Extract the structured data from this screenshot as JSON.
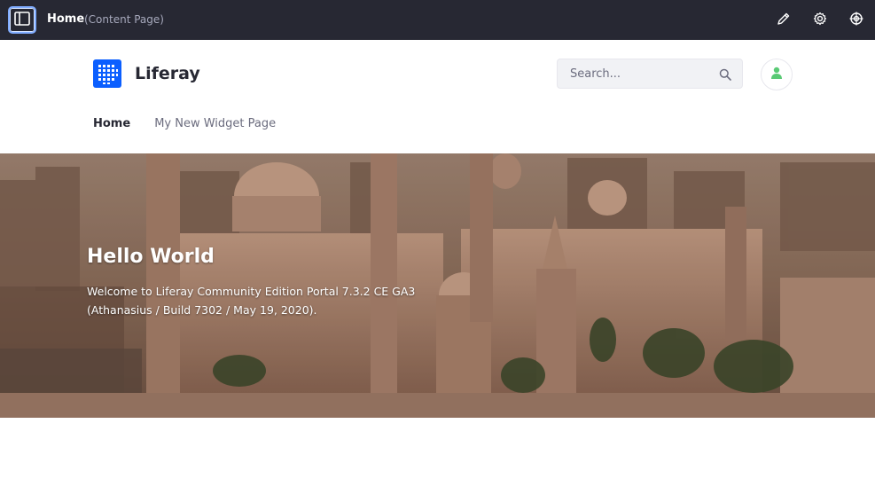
{
  "control_menu": {
    "page_title": "Home",
    "page_subtitle": "(Content Page)",
    "icons": [
      "sidebar-toggle-icon",
      "pencil-icon",
      "gear-icon",
      "simulation-icon"
    ]
  },
  "header": {
    "site_name": "Liferay",
    "search": {
      "placeholder": "Search..."
    },
    "nav": [
      {
        "label": "Home",
        "active": true
      },
      {
        "label": "My New Widget Page",
        "active": false
      }
    ]
  },
  "banner": {
    "title": "Hello World",
    "text_line1": "Welcome to Liferay Community Edition Portal 7.3.2 CE GA3",
    "text_line2": "(Athanasius / Build 7302 / May 19, 2020)."
  },
  "colors": {
    "control_menu_bg": "#272833",
    "brand": "#0b5fff",
    "avatar": "#5aca75"
  }
}
